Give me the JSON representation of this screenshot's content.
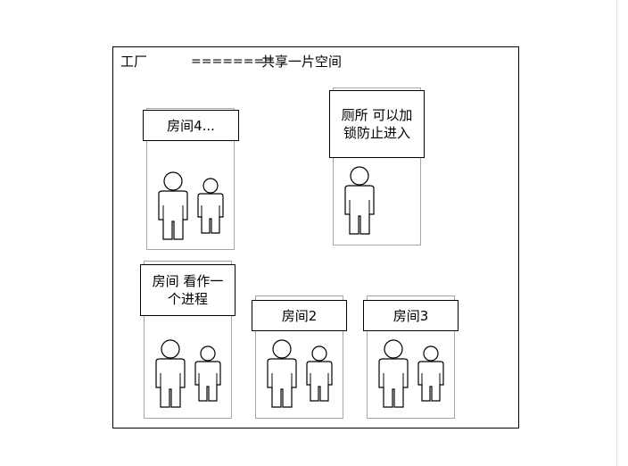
{
  "factory": {
    "title": "工厂",
    "separator": "========",
    "subtitle": "共享一片空间"
  },
  "rooms": {
    "room4": {
      "label": "房间4..."
    },
    "toilet": {
      "label": "厕所 可以加锁防止进入"
    },
    "room1": {
      "label": "房间 看作一个进程"
    },
    "room2": {
      "label": "房间2"
    },
    "room3": {
      "label": "房间3"
    }
  }
}
